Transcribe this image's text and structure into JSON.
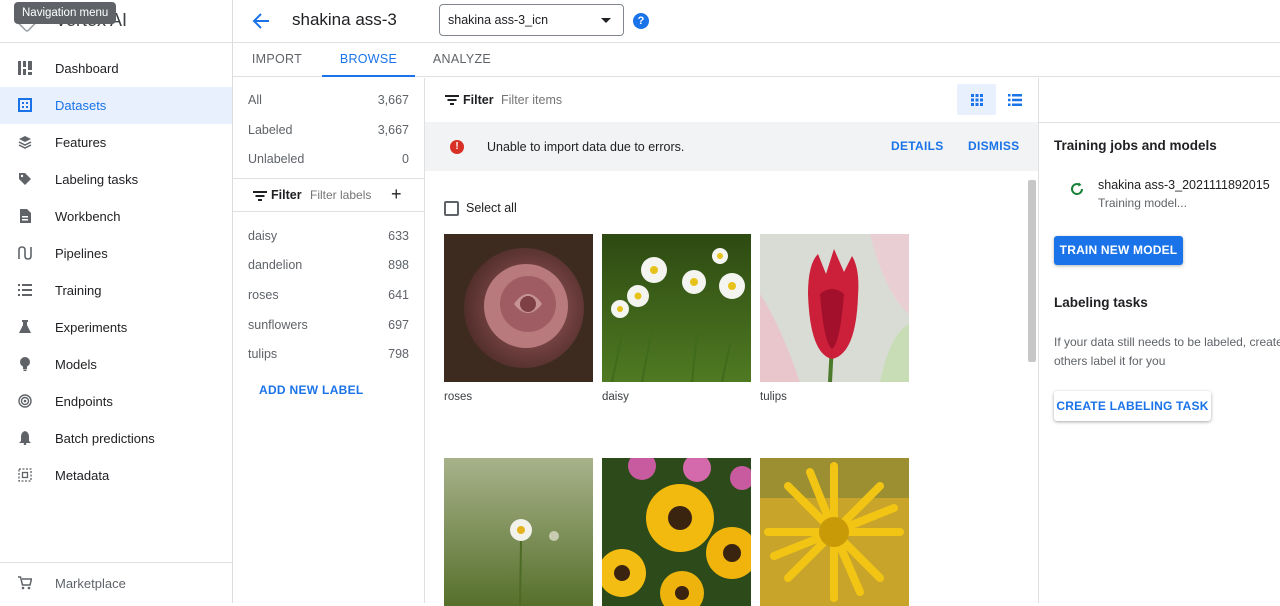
{
  "tooltip": "Navigation menu",
  "sidebar": {
    "product": "Vertex AI",
    "items": [
      {
        "label": "Dashboard",
        "icon": "dashboard-icon"
      },
      {
        "label": "Datasets",
        "icon": "datasets-icon",
        "active": true
      },
      {
        "label": "Features",
        "icon": "features-icon"
      },
      {
        "label": "Labeling tasks",
        "icon": "label-tag-icon"
      },
      {
        "label": "Workbench",
        "icon": "workbench-icon"
      },
      {
        "label": "Pipelines",
        "icon": "pipelines-icon"
      },
      {
        "label": "Training",
        "icon": "training-icon"
      },
      {
        "label": "Experiments",
        "icon": "experiments-flask-icon"
      },
      {
        "label": "Models",
        "icon": "models-bulb-icon"
      },
      {
        "label": "Endpoints",
        "icon": "endpoints-icon"
      },
      {
        "label": "Batch predictions",
        "icon": "batch-predictions-bell-icon"
      },
      {
        "label": "Metadata",
        "icon": "metadata-icon"
      }
    ],
    "footer": {
      "label": "Marketplace",
      "icon": "marketplace-cart-icon"
    }
  },
  "header": {
    "title": "shakina ass-3",
    "dataset_select": {
      "value": "shakina ass-3_icn"
    }
  },
  "tabs": [
    {
      "label": "IMPORT"
    },
    {
      "label": "BROWSE",
      "active": true
    },
    {
      "label": "ANALYZE"
    }
  ],
  "labels_panel": {
    "counts": [
      {
        "label": "All",
        "value": "3,667"
      },
      {
        "label": "Labeled",
        "value": "3,667"
      },
      {
        "label": "Unlabeled",
        "value": "0"
      }
    ],
    "filter_label": "Filter",
    "filter_placeholder": "Filter labels",
    "labels": [
      {
        "label": "daisy",
        "count": "633"
      },
      {
        "label": "dandelion",
        "count": "898"
      },
      {
        "label": "roses",
        "count": "641"
      },
      {
        "label": "sunflowers",
        "count": "697"
      },
      {
        "label": "tulips",
        "count": "798"
      }
    ],
    "add_label": "ADD NEW LABEL"
  },
  "main": {
    "filter_label": "Filter",
    "filter_placeholder": "Filter items",
    "banner": {
      "text": "Unable to import data due to errors.",
      "details": "DETAILS",
      "dismiss": "DISMISS",
      "color": "#d93025"
    },
    "select_all": "Select all",
    "images": [
      {
        "caption": "roses"
      },
      {
        "caption": "daisy"
      },
      {
        "caption": "tulips"
      },
      {
        "caption": ""
      },
      {
        "caption": ""
      },
      {
        "caption": ""
      }
    ]
  },
  "right_panel": {
    "training_heading": "Training jobs and models",
    "job": {
      "name": "shakina ass-3_2021111892015",
      "status": "Training model..."
    },
    "train_button": "TRAIN NEW MODEL",
    "labeling_heading": "Labeling tasks",
    "labeling_desc": "If your data still needs to be labeled, create others label it for you",
    "labeling_button": "CREATE LABELING TASK"
  },
  "colors": {
    "accent": "#1a73e8",
    "active_bg": "#e8f0fe",
    "spinner": "#188038"
  }
}
